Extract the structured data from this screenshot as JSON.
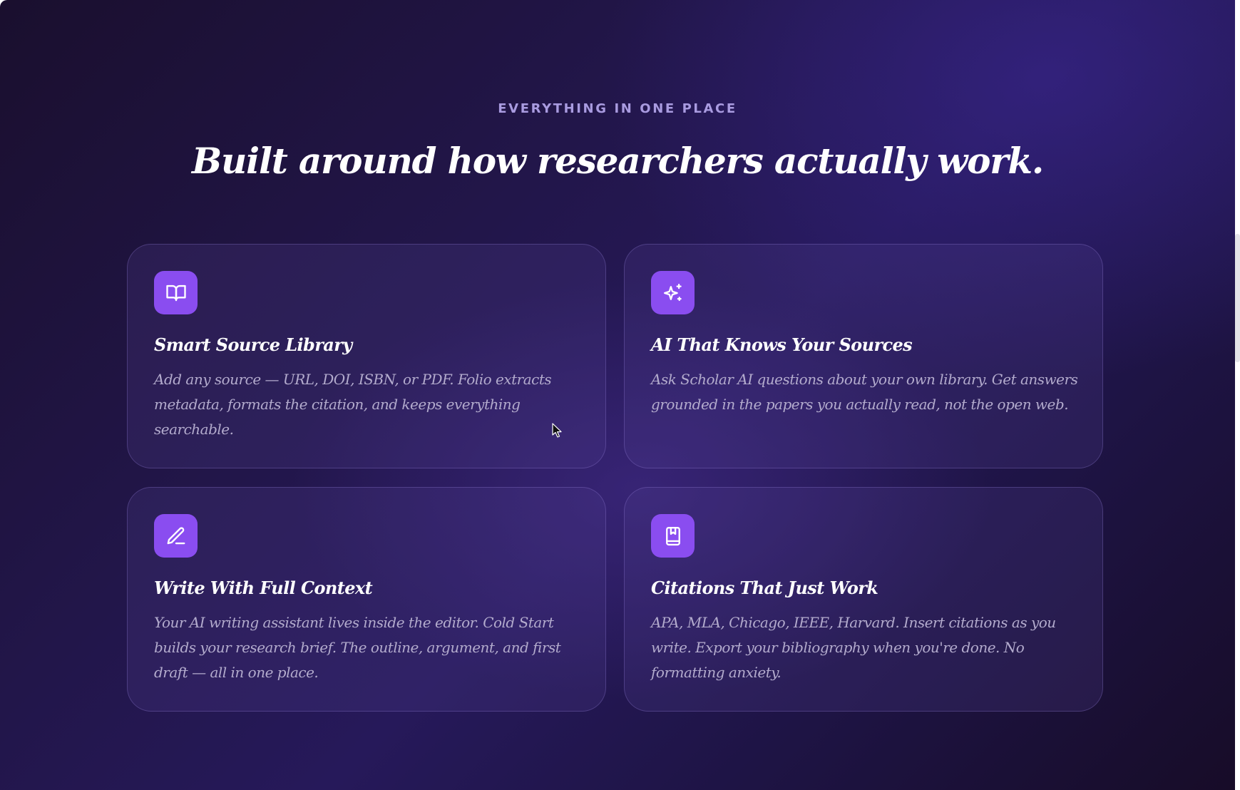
{
  "section": {
    "eyebrow": "EVERYTHING IN ONE PLACE",
    "headline": "Built around how researchers actually work."
  },
  "colors": {
    "accent": "#8a4df0",
    "eyebrow": "#a99be0",
    "background": "#22164a",
    "card_text": "#b3abcd"
  },
  "features": [
    {
      "icon": "open-book-icon",
      "title": "Smart Source Library",
      "description": "Add any source — URL, DOI, ISBN, or PDF. Folio extracts metadata, formats the citation, and keeps everything searchable."
    },
    {
      "icon": "sparkles-icon",
      "title": "AI That Knows Your Sources",
      "description": "Ask Scholar AI questions about your own library. Get answers grounded in the papers you actually read, not the open web."
    },
    {
      "icon": "pencil-icon",
      "title": "Write With Full Context",
      "description": "Your AI writing assistant lives inside the editor. Cold Start builds your research brief. The outline, argument, and first draft — all in one place."
    },
    {
      "icon": "bookmark-book-icon",
      "title": "Citations That Just Work",
      "description": "APA, MLA, Chicago, IEEE, Harvard. Insert citations as you write. Export your bibliography when you're done. No formatting anxiety."
    }
  ]
}
